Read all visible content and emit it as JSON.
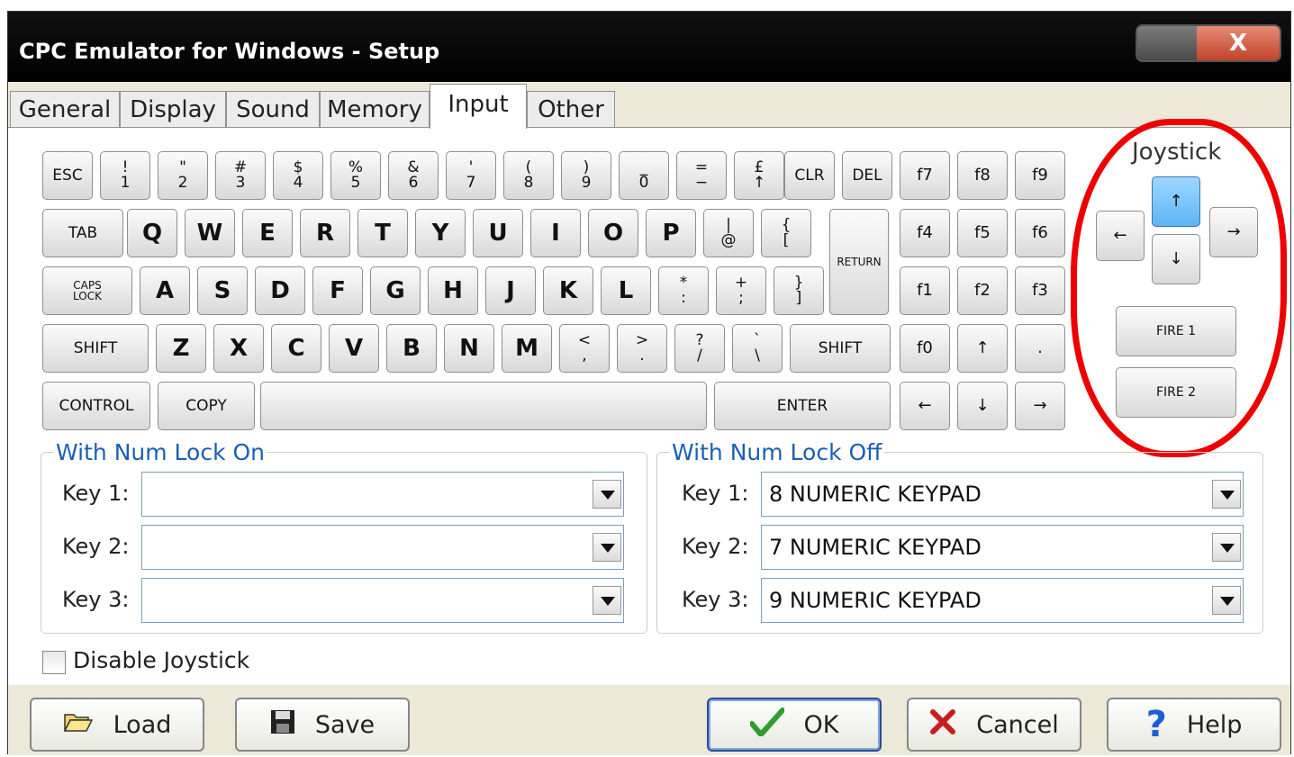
{
  "window": {
    "title": "CPC Emulator for Windows - Setup",
    "close_label": "X"
  },
  "tabs": [
    {
      "label": "General"
    },
    {
      "label": "Display"
    },
    {
      "label": "Sound"
    },
    {
      "label": "Memory"
    },
    {
      "label": "Input",
      "active": true
    },
    {
      "label": "Other"
    }
  ],
  "keyboard": {
    "row1": [
      {
        "name": "esc",
        "label": "ESC"
      },
      {
        "name": "1",
        "top": "!",
        "bottom": "1"
      },
      {
        "name": "2",
        "top": "\"",
        "bottom": "2"
      },
      {
        "name": "3",
        "top": "#",
        "bottom": "3"
      },
      {
        "name": "4",
        "top": "$",
        "bottom": "4"
      },
      {
        "name": "5",
        "top": "%",
        "bottom": "5"
      },
      {
        "name": "6",
        "top": "&",
        "bottom": "6"
      },
      {
        "name": "7",
        "top": "'",
        "bottom": "7"
      },
      {
        "name": "8",
        "top": "(",
        "bottom": "8"
      },
      {
        "name": "9",
        "top": ")",
        "bottom": "9"
      },
      {
        "name": "0",
        "top": "_",
        "bottom": "0"
      },
      {
        "name": "minus",
        "top": "=",
        "bottom": "−"
      },
      {
        "name": "pound",
        "top": "£",
        "bottom": "↑"
      },
      {
        "name": "clr",
        "label": "CLR"
      },
      {
        "name": "del",
        "label": "DEL"
      },
      {
        "name": "f7",
        "label": "f7"
      },
      {
        "name": "f8",
        "label": "f8"
      },
      {
        "name": "f9",
        "label": "f9"
      }
    ],
    "row2": [
      {
        "name": "tab",
        "label": "TAB"
      },
      {
        "name": "q",
        "label": "Q"
      },
      {
        "name": "w",
        "label": "W"
      },
      {
        "name": "e",
        "label": "E"
      },
      {
        "name": "r",
        "label": "R"
      },
      {
        "name": "t",
        "label": "T"
      },
      {
        "name": "y",
        "label": "Y"
      },
      {
        "name": "u",
        "label": "U"
      },
      {
        "name": "i",
        "label": "I"
      },
      {
        "name": "o",
        "label": "O"
      },
      {
        "name": "p",
        "label": "P"
      },
      {
        "name": "at",
        "top": "|",
        "bottom": "@"
      },
      {
        "name": "bracket-open",
        "top": "{",
        "bottom": "["
      },
      {
        "name": "return",
        "label": "RETURN"
      },
      {
        "name": "f4",
        "label": "f4"
      },
      {
        "name": "f5",
        "label": "f5"
      },
      {
        "name": "f6",
        "label": "f6"
      }
    ],
    "row3": [
      {
        "name": "caps-lock",
        "top": "CAPS",
        "bottom": "LOCK"
      },
      {
        "name": "a",
        "label": "A"
      },
      {
        "name": "s",
        "label": "S"
      },
      {
        "name": "d",
        "label": "D"
      },
      {
        "name": "f",
        "label": "F"
      },
      {
        "name": "g",
        "label": "G"
      },
      {
        "name": "h",
        "label": "H"
      },
      {
        "name": "j",
        "label": "J"
      },
      {
        "name": "k",
        "label": "K"
      },
      {
        "name": "l",
        "label": "L"
      },
      {
        "name": "colon",
        "top": "*",
        "bottom": ":"
      },
      {
        "name": "semicolon",
        "top": "+",
        "bottom": ";"
      },
      {
        "name": "bracket-close",
        "top": "}",
        "bottom": "]"
      },
      {
        "name": "f1",
        "label": "f1"
      },
      {
        "name": "f2",
        "label": "f2"
      },
      {
        "name": "f3",
        "label": "f3"
      }
    ],
    "row4": [
      {
        "name": "shift-left",
        "label": "SHIFT"
      },
      {
        "name": "z",
        "label": "Z"
      },
      {
        "name": "x",
        "label": "X"
      },
      {
        "name": "c",
        "label": "C"
      },
      {
        "name": "v",
        "label": "V"
      },
      {
        "name": "b",
        "label": "B"
      },
      {
        "name": "n",
        "label": "N"
      },
      {
        "name": "m",
        "label": "M"
      },
      {
        "name": "comma",
        "top": "<",
        "bottom": ","
      },
      {
        "name": "period",
        "top": ">",
        "bottom": "."
      },
      {
        "name": "slash",
        "top": "?",
        "bottom": "/"
      },
      {
        "name": "backslash",
        "top": "`",
        "bottom": "\\"
      },
      {
        "name": "shift-right",
        "label": "SHIFT"
      },
      {
        "name": "f0",
        "label": "f0"
      },
      {
        "name": "cursor-up",
        "label": "↑"
      },
      {
        "name": "keypad-dot",
        "label": "."
      }
    ],
    "row5": [
      {
        "name": "control",
        "label": "CONTROL"
      },
      {
        "name": "copy",
        "label": "COPY"
      },
      {
        "name": "space",
        "label": ""
      },
      {
        "name": "enter",
        "label": "ENTER"
      },
      {
        "name": "cursor-left",
        "label": "←"
      },
      {
        "name": "cursor-down",
        "label": "↓"
      },
      {
        "name": "cursor-right",
        "label": "→"
      }
    ]
  },
  "joystick": {
    "label": "Joystick",
    "up": "↑",
    "left": "←",
    "right": "→",
    "down": "↓",
    "fire1": "FIRE 1",
    "fire2": "FIRE 2",
    "highlight_color": "#e00000"
  },
  "num_lock_on": {
    "legend": "With Num Lock On",
    "rows": [
      {
        "label": "Key 1:",
        "value": ""
      },
      {
        "label": "Key 2:",
        "value": ""
      },
      {
        "label": "Key 3:",
        "value": ""
      }
    ]
  },
  "num_lock_off": {
    "legend": "With Num Lock Off",
    "rows": [
      {
        "label": "Key 1:",
        "value": "8 NUMERIC KEYPAD"
      },
      {
        "label": "Key 2:",
        "value": "7 NUMERIC KEYPAD"
      },
      {
        "label": "Key 3:",
        "value": "9 NUMERIC KEYPAD"
      }
    ]
  },
  "disable_joystick": {
    "label": "Disable Joystick",
    "checked": false
  },
  "buttons": {
    "load": "Load",
    "save": "Save",
    "ok": "OK",
    "cancel": "Cancel",
    "help": "Help"
  }
}
